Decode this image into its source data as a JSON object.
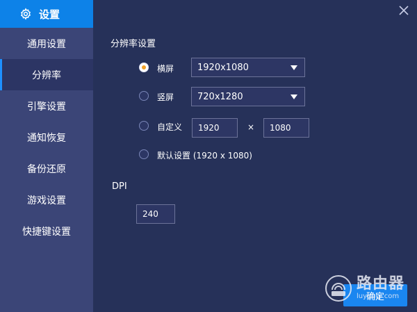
{
  "sidebar": {
    "header": {
      "title": "设置",
      "icon": "gear-icon"
    },
    "items": [
      {
        "label": "通用设置",
        "active": false
      },
      {
        "label": "分辨率",
        "active": true
      },
      {
        "label": "引擎设置",
        "active": false
      },
      {
        "label": "通知恢复",
        "active": false
      },
      {
        "label": "备份还原",
        "active": false
      },
      {
        "label": "游戏设置",
        "active": false
      },
      {
        "label": "快捷键设置",
        "active": false
      }
    ]
  },
  "main": {
    "resolution_section_title": "分辨率设置",
    "options": {
      "landscape": {
        "label": "横屏",
        "value": "1920x1080",
        "checked": true
      },
      "portrait": {
        "label": "竖屏",
        "value": "720x1280",
        "checked": false
      },
      "custom": {
        "label": "自定义",
        "width": "1920",
        "times": "×",
        "height": "1080",
        "checked": false
      },
      "default": {
        "label": "默认设置 (1920 x 1080)",
        "checked": false
      }
    },
    "dpi_title": "DPI",
    "dpi_value": "240",
    "confirm_label": "确定"
  },
  "watermark": {
    "text_cn": "路由器",
    "text_en": "luyouqi.com"
  },
  "colors": {
    "accent": "#0d82e8",
    "sidebar_bg": "#3b4577",
    "main_bg": "#263159",
    "radio_selected": "#f2a128"
  }
}
